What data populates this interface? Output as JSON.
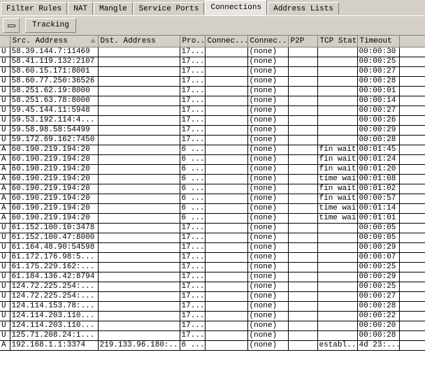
{
  "window": {
    "title": "Connections"
  },
  "tabs": [
    {
      "label": "Filter Rules",
      "active": false
    },
    {
      "label": "NAT",
      "active": false
    },
    {
      "label": "Mangle",
      "active": false
    },
    {
      "label": "Service Ports",
      "active": false
    },
    {
      "label": "Connections",
      "active": true
    },
    {
      "label": "Address Lists",
      "active": false
    }
  ],
  "toolbar": {
    "collapse_button_icon": "minus-icon",
    "tracking_label": "Tracking"
  },
  "table": {
    "columns": [
      {
        "key": "flag",
        "label": "",
        "sorted": false
      },
      {
        "key": "src",
        "label": "Src. Address",
        "sorted": true
      },
      {
        "key": "dst",
        "label": "Dst. Address",
        "sorted": false
      },
      {
        "key": "pro",
        "label": "Pro...",
        "sorted": false
      },
      {
        "key": "con1",
        "label": "Connec...",
        "sorted": false
      },
      {
        "key": "con2",
        "label": "Connec...",
        "sorted": false
      },
      {
        "key": "p2p",
        "label": "P2P",
        "sorted": false
      },
      {
        "key": "tcp",
        "label": "TCP State",
        "sorted": false
      },
      {
        "key": "tout",
        "label": "Timeout",
        "sorted": false
      },
      {
        "key": "pad",
        "label": "",
        "sorted": false
      }
    ],
    "rows": [
      {
        "flag": "U",
        "src": "58.39.144.7:11469",
        "dst": "",
        "dst_redacted": true,
        "pro": "17...",
        "con1": "",
        "con2": "(none)",
        "p2p": "",
        "tcp": "",
        "tout": "00:00:30"
      },
      {
        "flag": "U",
        "src": "58.41.119.132:2107",
        "dst": "",
        "dst_redacted": true,
        "pro": "17...",
        "con1": "",
        "con2": "(none)",
        "p2p": "",
        "tcp": "",
        "tout": "00:00:25"
      },
      {
        "flag": "U",
        "src": "58.60.15.171:8001",
        "dst": "",
        "dst_redacted": true,
        "pro": "17...",
        "con1": "",
        "con2": "(none)",
        "p2p": "",
        "tcp": "",
        "tout": "00:00:27"
      },
      {
        "flag": "U",
        "src": "58.60.77.250:36526",
        "dst": "",
        "dst_redacted": true,
        "pro": "17...",
        "con1": "",
        "con2": "(none)",
        "p2p": "",
        "tcp": "",
        "tout": "00:00:28"
      },
      {
        "flag": "U",
        "src": "58.251.62.19:8000",
        "dst": "",
        "dst_redacted": true,
        "pro": "17...",
        "con1": "",
        "con2": "(none)",
        "p2p": "",
        "tcp": "",
        "tout": "00:00:01"
      },
      {
        "flag": "U",
        "src": "58.251.63.78:8000",
        "dst": "",
        "dst_redacted": true,
        "pro": "17...",
        "con1": "",
        "con2": "(none)",
        "p2p": "",
        "tcp": "",
        "tout": "00:00:14"
      },
      {
        "flag": "U",
        "src": "59.45.144.11:5948",
        "dst": "",
        "dst_redacted": true,
        "pro": "17...",
        "con1": "",
        "con2": "(none)",
        "p2p": "",
        "tcp": "",
        "tout": "00:00:27"
      },
      {
        "flag": "U",
        "src": "59.53.192.114:4...",
        "dst": "",
        "dst_redacted": true,
        "pro": "17...",
        "con1": "",
        "con2": "(none)",
        "p2p": "",
        "tcp": "",
        "tout": "00:00:26"
      },
      {
        "flag": "U",
        "src": "59.58.98.58:54499",
        "dst": "",
        "dst_redacted": true,
        "pro": "17...",
        "con1": "",
        "con2": "(none)",
        "p2p": "",
        "tcp": "",
        "tout": "00:00:29"
      },
      {
        "flag": "U",
        "src": "59.172.69.162:7450",
        "dst": "",
        "dst_redacted": true,
        "pro": "17...",
        "con1": "",
        "con2": "(none)",
        "p2p": "",
        "tcp": "",
        "tout": "00:00:28"
      },
      {
        "flag": "A",
        "src": "60.190.219.194:20",
        "dst": "",
        "dst_redacted": true,
        "pro": "6 ...",
        "con1": "",
        "con2": "(none)",
        "p2p": "",
        "tcp": "fin wait",
        "tout": "00:01:45"
      },
      {
        "flag": "A",
        "src": "60.190.219.194:20",
        "dst": "",
        "dst_redacted": true,
        "pro": "6 ...",
        "con1": "",
        "con2": "(none)",
        "p2p": "",
        "tcp": "fin wait",
        "tout": "00:01:24"
      },
      {
        "flag": "A",
        "src": "60.190.219.194:20",
        "dst": "",
        "dst_redacted": true,
        "pro": "6 ...",
        "con1": "",
        "con2": "(none)",
        "p2p": "",
        "tcp": "fin wait",
        "tout": "00:01:20"
      },
      {
        "flag": "A",
        "src": "60.190.219.194:20",
        "dst": "",
        "dst_redacted": true,
        "pro": "6 ...",
        "con1": "",
        "con2": "(none)",
        "p2p": "",
        "tcp": "time wait",
        "tout": "00:01:08"
      },
      {
        "flag": "A",
        "src": "60.190.219.194:20",
        "dst": "",
        "dst_redacted": true,
        "pro": "6 ...",
        "con1": "",
        "con2": "(none)",
        "p2p": "",
        "tcp": "fin wait",
        "tout": "00:01:02"
      },
      {
        "flag": "A",
        "src": "60.190.219.194:20",
        "dst": "",
        "dst_redacted": true,
        "pro": "6 ...",
        "con1": "",
        "con2": "(none)",
        "p2p": "",
        "tcp": "fin wait",
        "tout": "00:00:57"
      },
      {
        "flag": "A",
        "src": "60.190.219.194:20",
        "dst": "",
        "dst_redacted": true,
        "pro": "6 ...",
        "con1": "",
        "con2": "(none)",
        "p2p": "",
        "tcp": "time wait",
        "tout": "00:01:14"
      },
      {
        "flag": "A",
        "src": "60.190.219.194:20",
        "dst": "",
        "dst_redacted": true,
        "pro": "6 ...",
        "con1": "",
        "con2": "(none)",
        "p2p": "",
        "tcp": "time wait",
        "tout": "00:01:01"
      },
      {
        "flag": "U",
        "src": "61.152.100.10:3478",
        "dst": "",
        "dst_redacted": true,
        "pro": "17...",
        "con1": "",
        "con2": "(none)",
        "p2p": "",
        "tcp": "",
        "tout": "00:00:05"
      },
      {
        "flag": "U",
        "src": "61.152.100.47:8000",
        "dst": "",
        "dst_redacted": true,
        "pro": "17...",
        "con1": "",
        "con2": "(none)",
        "p2p": "",
        "tcp": "",
        "tout": "00:00:05"
      },
      {
        "flag": "U",
        "src": "61.164.48.90:54598",
        "dst": "",
        "dst_redacted": true,
        "pro": "17...",
        "con1": "",
        "con2": "(none)",
        "p2p": "",
        "tcp": "",
        "tout": "00:00:29"
      },
      {
        "flag": "U",
        "src": "61.172.176.98:5...",
        "dst": "",
        "dst_redacted": true,
        "pro": "17...",
        "con1": "",
        "con2": "(none)",
        "p2p": "",
        "tcp": "",
        "tout": "00:00:07"
      },
      {
        "flag": "U",
        "src": "61.175.229.162:...",
        "dst": "",
        "dst_redacted": true,
        "pro": "17...",
        "con1": "",
        "con2": "(none)",
        "p2p": "",
        "tcp": "",
        "tout": "00:00:25"
      },
      {
        "flag": "U",
        "src": "61.184.136.42:8794",
        "dst": "",
        "dst_redacted": true,
        "pro": "17...",
        "con1": "",
        "con2": "(none)",
        "p2p": "",
        "tcp": "",
        "tout": "00:00:29"
      },
      {
        "flag": "U",
        "src": "124.72.225.254:...",
        "dst": "",
        "dst_redacted": true,
        "pro": "17...",
        "con1": "",
        "con2": "(none)",
        "p2p": "",
        "tcp": "",
        "tout": "00:00:25"
      },
      {
        "flag": "U",
        "src": "124.72.225.254:...",
        "dst": "",
        "dst_redacted": true,
        "pro": "17...",
        "con1": "",
        "con2": "(none)",
        "p2p": "",
        "tcp": "",
        "tout": "00:00:27"
      },
      {
        "flag": "U",
        "src": "124.114.153.78:...",
        "dst": "",
        "dst_redacted": true,
        "pro": "17...",
        "con1": "",
        "con2": "(none)",
        "p2p": "",
        "tcp": "",
        "tout": "00:00:28"
      },
      {
        "flag": "U",
        "src": "124.114.203.110...",
        "dst": "",
        "dst_redacted": true,
        "pro": "17...",
        "con1": "",
        "con2": "(none)",
        "p2p": "",
        "tcp": "",
        "tout": "00:00:22"
      },
      {
        "flag": "U",
        "src": "124.114.203.110...",
        "dst": "",
        "dst_redacted": true,
        "pro": "17...",
        "con1": "",
        "con2": "(none)",
        "p2p": "",
        "tcp": "",
        "tout": "00:00:20"
      },
      {
        "flag": "U",
        "src": "125.71.208.24:1...",
        "dst": "",
        "dst_redacted": true,
        "pro": "17...",
        "con1": "",
        "con2": "(none)",
        "p2p": "",
        "tcp": "",
        "tout": "00:00:28"
      },
      {
        "flag": "A",
        "src": "192.168.1.1:3374",
        "dst": "219.133.96.180:...",
        "dst_redacted": false,
        "pro": "6 ...",
        "con1": "",
        "con2": "(none)",
        "p2p": "",
        "tcp": "establ...",
        "tout": "4d 23:..."
      }
    ]
  },
  "colors": {
    "window_face": "#d4d0c8",
    "active_tab": "#e8e5de",
    "grid_line": "#000000",
    "header_line": "#808080",
    "redaction": "#000000",
    "row_background": "#ffffff"
  }
}
